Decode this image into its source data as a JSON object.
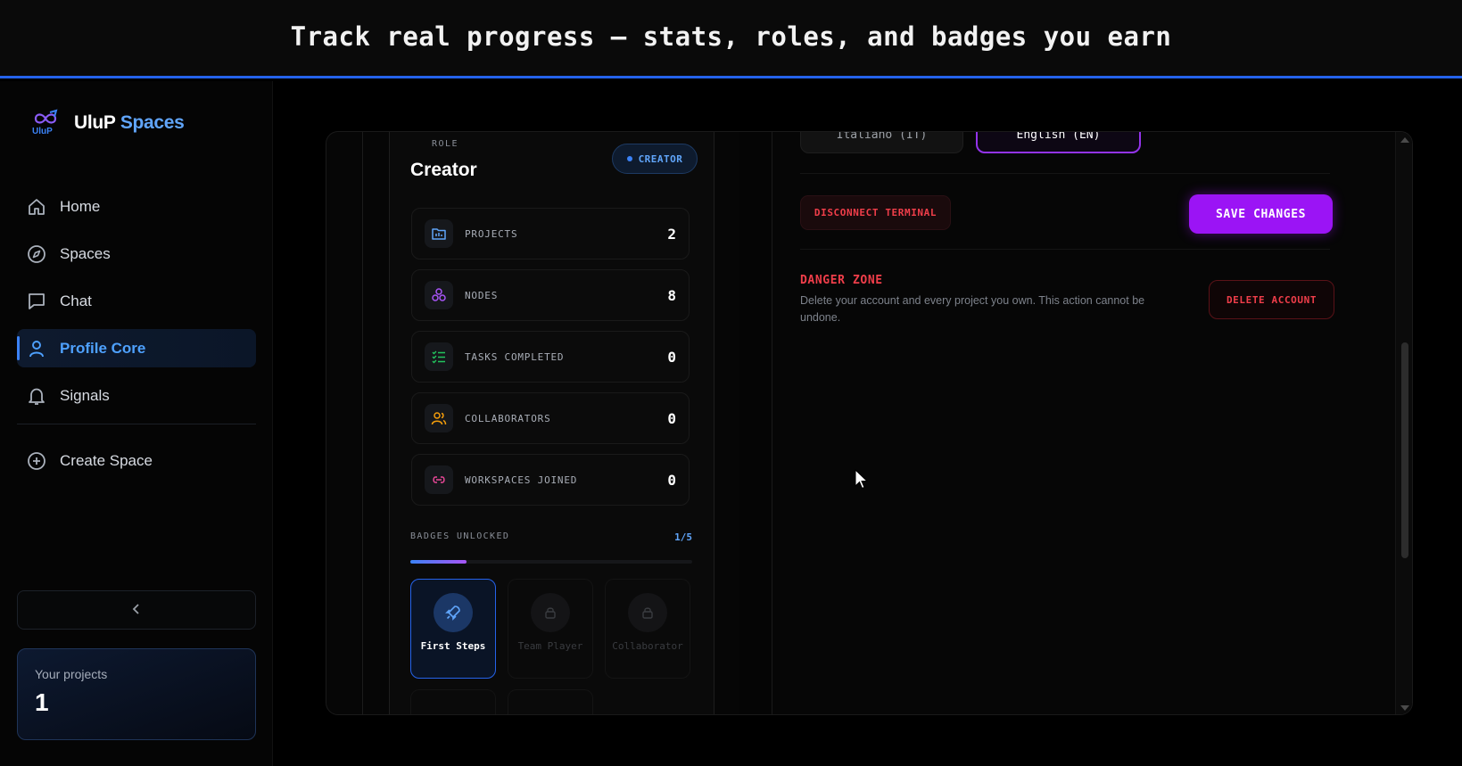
{
  "banner": {
    "text": "Track real progress — stats, roles, and badges you earn"
  },
  "brand": {
    "name_first": "UluP",
    "name_second": "Spaces",
    "logo_text": "UluP"
  },
  "sidebar": {
    "items": [
      {
        "label": "Home",
        "icon": "home-icon"
      },
      {
        "label": "Spaces",
        "icon": "compass-icon"
      },
      {
        "label": "Chat",
        "icon": "chat-icon"
      },
      {
        "label": "Profile Core",
        "icon": "user-icon",
        "active": true
      },
      {
        "label": "Signals",
        "icon": "bell-icon"
      }
    ],
    "create_label": "Create Space",
    "collapse_icon": "chevron-left-icon",
    "projects": {
      "label": "Your projects",
      "value": "1"
    }
  },
  "profile": {
    "role_label": "ROLE",
    "role_name": "Creator",
    "role_pill": "CREATOR",
    "stats": [
      {
        "label": "PROJECTS",
        "value": "2",
        "icon": "folder-chart-icon",
        "color": "#60a5fa"
      },
      {
        "label": "NODES",
        "value": "8",
        "icon": "nodes-icon",
        "color": "#a855f7"
      },
      {
        "label": "TASKS COMPLETED",
        "value": "0",
        "icon": "checklist-icon",
        "color": "#22c55e"
      },
      {
        "label": "COLLABORATORS",
        "value": "0",
        "icon": "users-icon",
        "color": "#f59e0b"
      },
      {
        "label": "WORKSPACES JOINED",
        "value": "0",
        "icon": "link-icon",
        "color": "#ec4899"
      }
    ],
    "badges_label": "BADGES UNLOCKED",
    "badges_count": "1/5",
    "badges_progress": 0.2,
    "badges": [
      {
        "name": "First Steps",
        "unlocked": true,
        "icon": "rocket-icon"
      },
      {
        "name": "Team Player",
        "unlocked": false,
        "icon": "lock-icon"
      },
      {
        "name": "Collaborator",
        "unlocked": false,
        "icon": "lock-icon"
      }
    ]
  },
  "settings": {
    "lang_it": "Italiano (IT)",
    "lang_en": "English (EN)",
    "disconnect_label": "DISCONNECT TERMINAL",
    "save_label": "SAVE CHANGES",
    "danger_title": "DANGER ZONE",
    "danger_desc": "Delete your account and every project you own. This action cannot be undone.",
    "delete_label": "DELETE ACCOUNT"
  },
  "colors": {
    "accent": "#3b82f6",
    "purple": "#9b14f5",
    "danger": "#f03e4a"
  }
}
